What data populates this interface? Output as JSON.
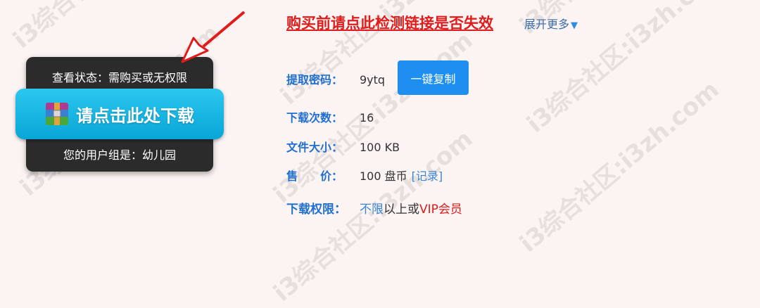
{
  "download_panel": {
    "status_text": "查看状态：需购买或无权限",
    "download_button_label": "请点击此处下载",
    "user_group_text": "您的用户组是：幼儿园"
  },
  "info": {
    "check_link_text": "购买前请点此检测链接是否失效",
    "expand_text": "展开更多",
    "password_label": "提取密码：",
    "password_value": "9ytq",
    "copy_button_label": "一键复制",
    "count_label": "下载次数：",
    "count_value": "16",
    "size_label": "文件大小：",
    "size_value": "100 KB",
    "price_label": "售　　价：",
    "price_value": "100 盘币",
    "record_link": "[记录]",
    "permission_label": "下载权限：",
    "permission_part1": "不限",
    "permission_part2": "以上或",
    "permission_part3": "VIP会员"
  },
  "watermark_text": "i3综合社区:i3zh.com",
  "colors": {
    "accent_blue": "#1e8ff0",
    "link_red": "#e01b1b",
    "download_button": "#08a6d8",
    "panel_bg": "#2b2b2b"
  }
}
